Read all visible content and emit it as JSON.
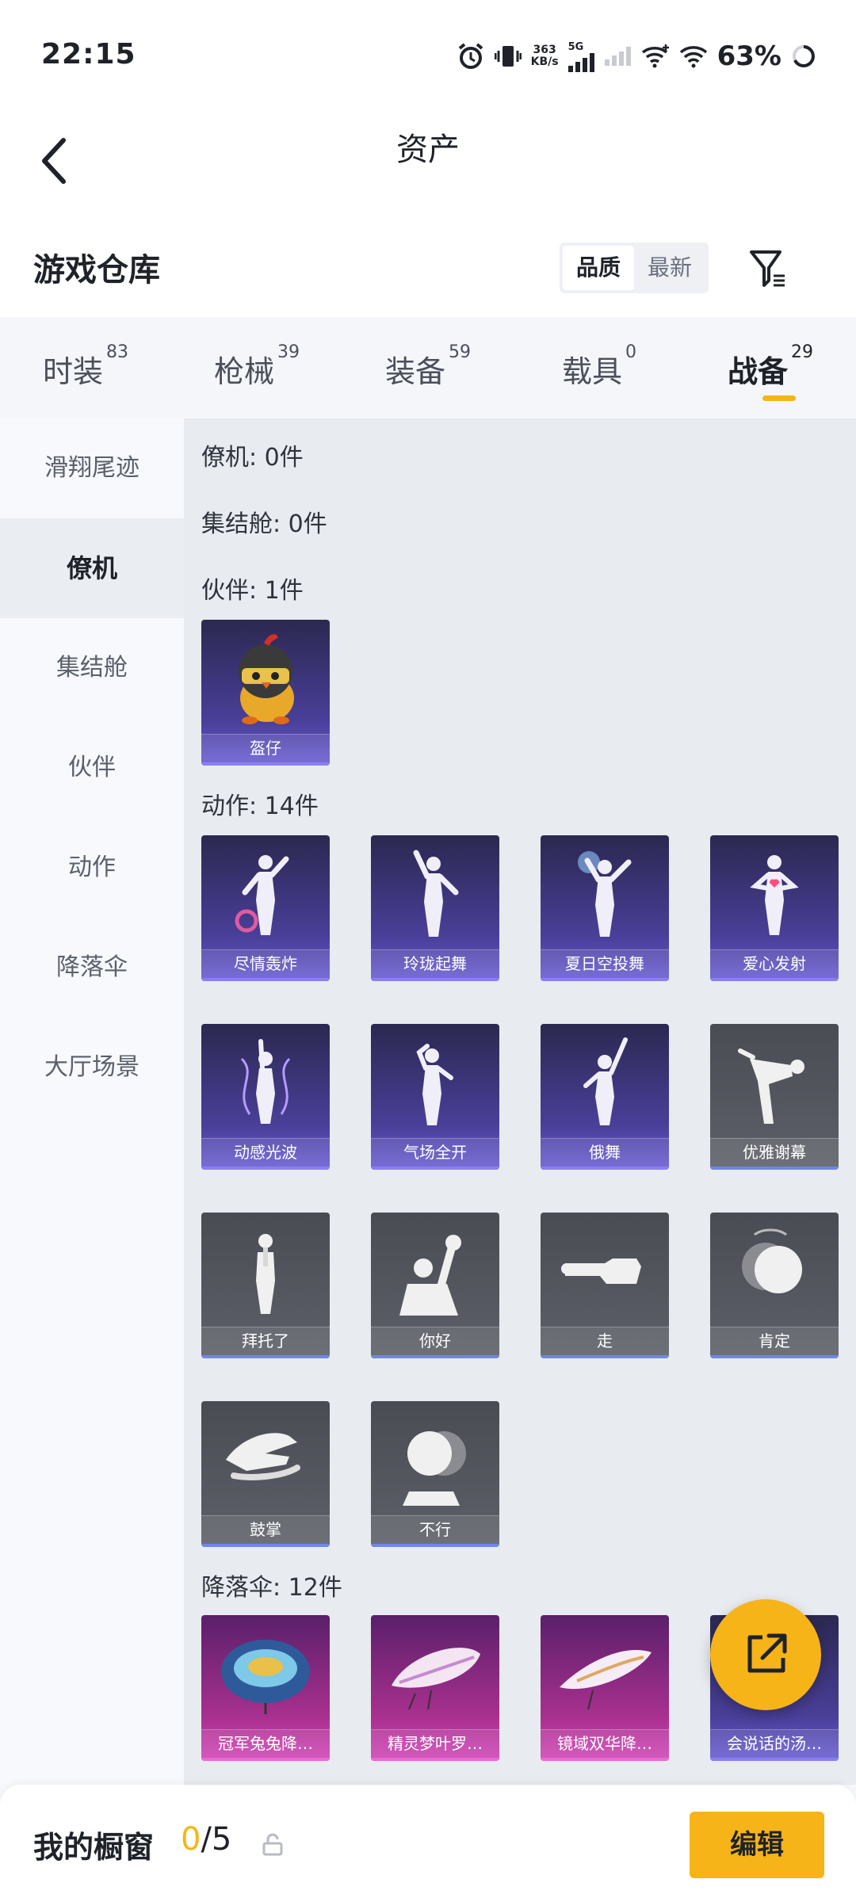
{
  "status_bar": {
    "time": "22:15",
    "net_speed_top": "363",
    "net_speed_bottom": "KB/s",
    "network": "5G",
    "battery": "63%"
  },
  "header": {
    "title": "资产"
  },
  "subheader": {
    "title": "游戏仓库",
    "sort_options": [
      "品质",
      "最新"
    ],
    "sort_selected": "品质"
  },
  "tabs": [
    {
      "label": "时装",
      "count": "83"
    },
    {
      "label": "枪械",
      "count": "39"
    },
    {
      "label": "装备",
      "count": "59"
    },
    {
      "label": "载具",
      "count": "0"
    },
    {
      "label": "战备",
      "count": "29",
      "active": true
    }
  ],
  "sidebar": {
    "items": [
      "滑翔尾迹",
      "僚机",
      "集结舱",
      "伙伴",
      "动作",
      "降落伞",
      "大厅场景"
    ],
    "active": "僚机"
  },
  "sections": {
    "wingman": "僚机: 0件",
    "pod": "集结舱: 0件",
    "partner": "伙伴: 1件",
    "emote": "动作: 14件",
    "parachute": "降落伞: 12件"
  },
  "partner_items": [
    "盔仔"
  ],
  "emote_items": [
    "尽情轰炸",
    "玲珑起舞",
    "夏日空投舞",
    "爱心发射",
    "动感光波",
    "气场全开",
    "俄舞",
    "优雅谢幕",
    "拜托了",
    "你好",
    "走",
    "肯定",
    "鼓掌",
    "不行"
  ],
  "parachute_items": [
    "冠军兔兔降…",
    "精灵梦叶罗…",
    "镜域双华降…",
    "会说话的汤…"
  ],
  "bottom_bar": {
    "label": "我的橱窗",
    "count_current": "0",
    "count_sep": "/5",
    "edit": "编辑"
  },
  "colors": {
    "accent": "#f6b418",
    "rare_purple": "#4a3f9a",
    "common_gray": "#5d6068",
    "epic_magenta": "#a9308f"
  }
}
